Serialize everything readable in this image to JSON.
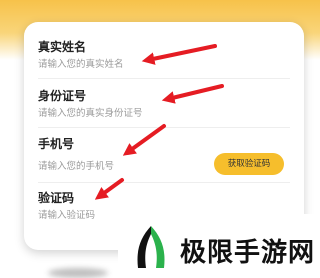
{
  "form": {
    "name": {
      "label": "真实姓名",
      "placeholder": "请输入您的真实姓名"
    },
    "id_card": {
      "label": "身份证号",
      "placeholder": "请输入您的真实身份证号"
    },
    "phone": {
      "label": "手机号",
      "placeholder": "请输入您的手机号"
    },
    "code": {
      "label": "验证码",
      "placeholder": "请输入验证码"
    },
    "get_code_button": "获取验证码"
  },
  "watermark": {
    "text": "极限手游网"
  },
  "colors": {
    "accent": "#f6be2c",
    "arrow": "#e51c23"
  }
}
